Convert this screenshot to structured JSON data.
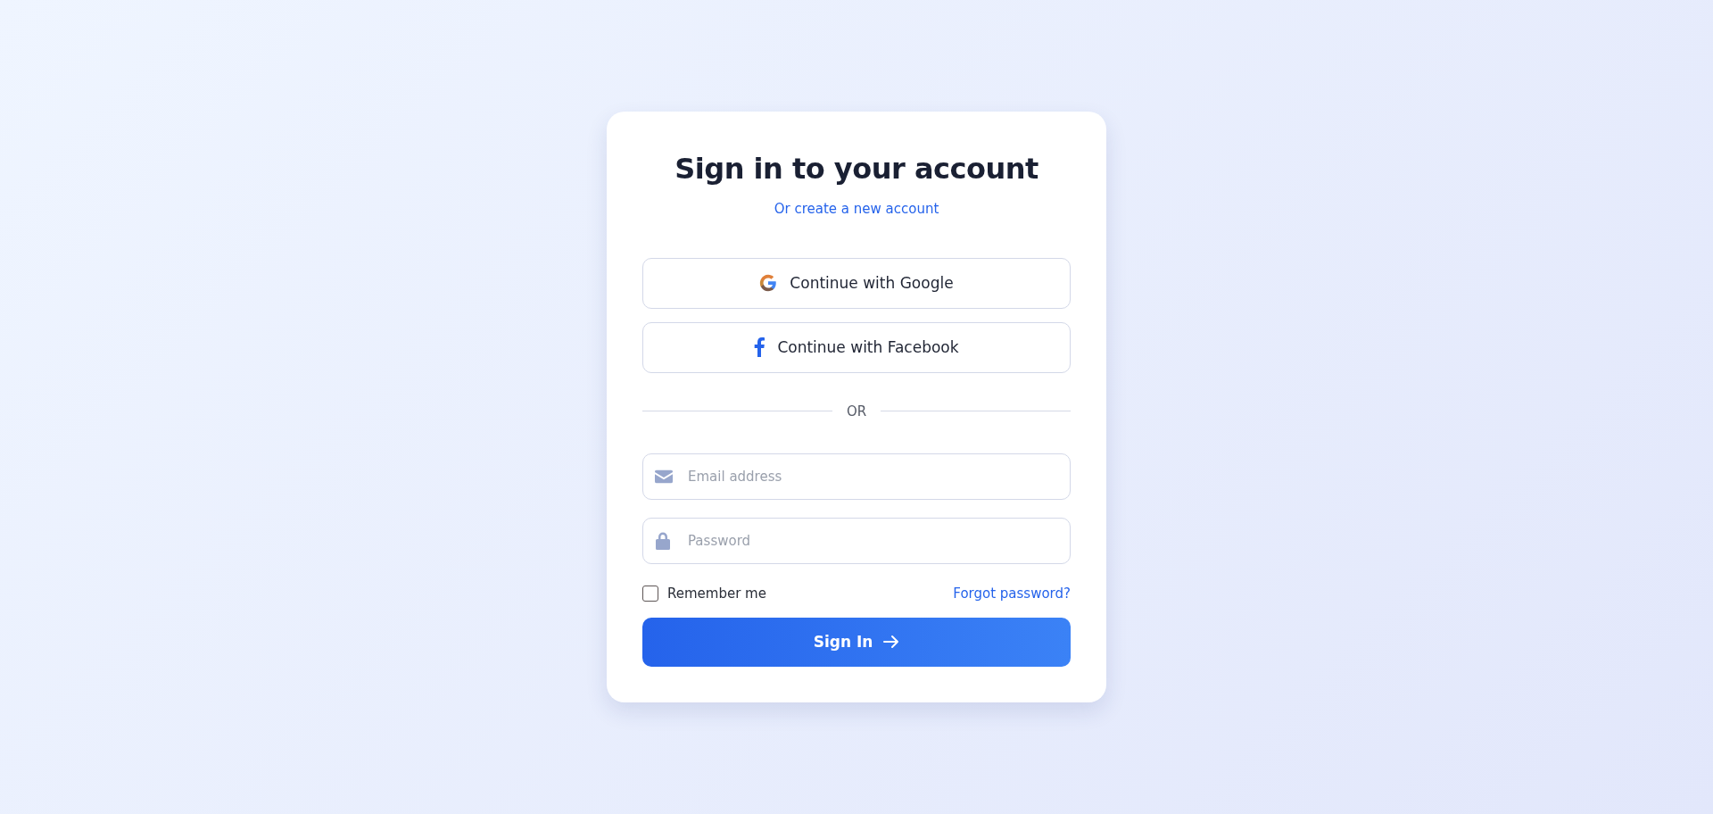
{
  "title": "Sign in to your account",
  "create_link": "Or create a new account",
  "social_buttons": [
    {
      "kind": "google",
      "label": "Continue with Google"
    },
    {
      "kind": "facebook",
      "label": "Continue with Facebook"
    }
  ],
  "divider": "OR",
  "fields": [
    {
      "kind": "email",
      "placeholder": "Email address"
    },
    {
      "kind": "password",
      "placeholder": "Password"
    }
  ],
  "remember": {
    "label": "Remember me",
    "checked": false
  },
  "forgot_link": "Forgot password?",
  "submit": "Sign In"
}
